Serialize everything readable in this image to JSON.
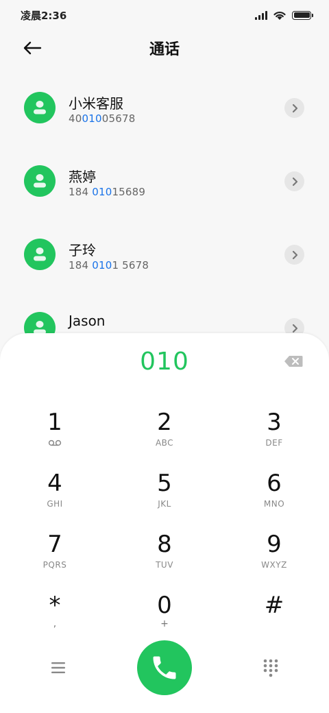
{
  "status_bar": {
    "time": "凌晨2:36"
  },
  "header": {
    "title": "通话"
  },
  "contacts": [
    {
      "name": "小米客服",
      "number_parts": [
        "40",
        "010",
        "05678"
      ]
    },
    {
      "name": "燕婷",
      "number_parts": [
        "184 ",
        "010",
        "15689"
      ]
    },
    {
      "name": "子玲",
      "number_parts": [
        "184 ",
        "010",
        "1 5678"
      ]
    },
    {
      "name": "Jason",
      "number_parts": [
        "",
        "",
        ""
      ]
    }
  ],
  "dialpad": {
    "entered_number": "010",
    "keys": [
      {
        "digit": "1",
        "letters": ""
      },
      {
        "digit": "2",
        "letters": "ABC"
      },
      {
        "digit": "3",
        "letters": "DEF"
      },
      {
        "digit": "4",
        "letters": "GHI"
      },
      {
        "digit": "5",
        "letters": "JKL"
      },
      {
        "digit": "6",
        "letters": "MNO"
      },
      {
        "digit": "7",
        "letters": "PQRS"
      },
      {
        "digit": "8",
        "letters": "TUV"
      },
      {
        "digit": "9",
        "letters": "WXYZ"
      },
      {
        "digit": "*",
        "letters": ","
      },
      {
        "digit": "0",
        "letters": "+"
      },
      {
        "digit": "#",
        "letters": ""
      }
    ]
  },
  "icons": {
    "back": "arrow-left-icon",
    "avatar": "person-icon",
    "detail": "chevron-right-icon",
    "delete": "backspace-icon",
    "voicemail": "voicemail-icon",
    "menu": "menu-icon",
    "call": "phone-icon",
    "keypad": "dialpad-icon"
  },
  "colors": {
    "accent": "#22c55e",
    "highlight": "#1a73e8",
    "background": "#f7f7f7",
    "sheet": "#ffffff"
  }
}
